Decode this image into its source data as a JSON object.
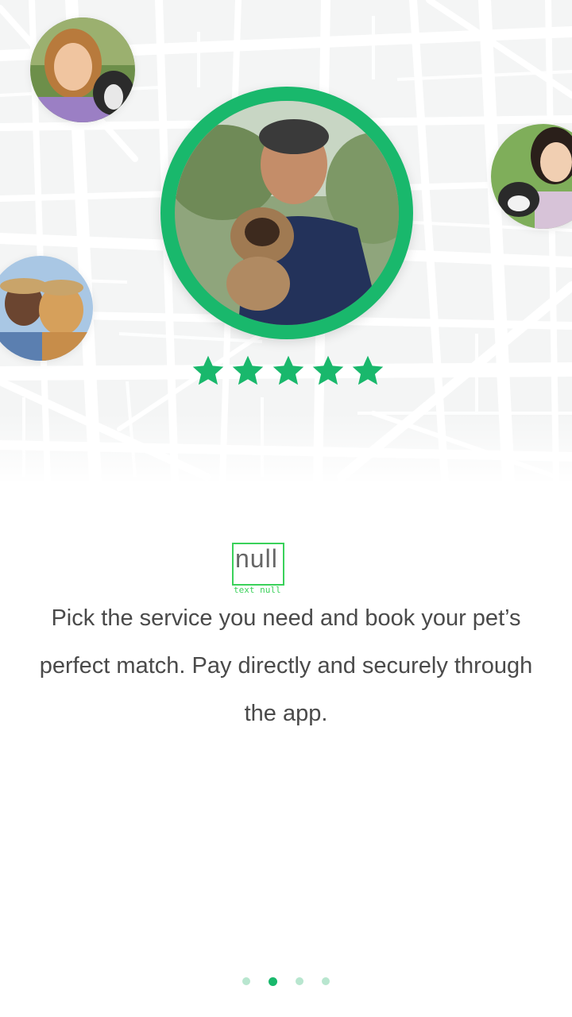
{
  "colors": {
    "accent": "#19b86c",
    "text": "#4a4a4a",
    "map_background": "#f4f5f5",
    "map_roads": "#ffffff",
    "dot_inactive": "#b8e6cf"
  },
  "hero": {
    "main_profile": {
      "image": "man-holding-small-dog-photo"
    },
    "rating": {
      "value": 5,
      "max": 5,
      "icon": "star-icon"
    },
    "side_profiles": [
      {
        "image": "woman-with-dog-photo"
      },
      {
        "image": "woman-with-dog-laughing-photo"
      },
      {
        "image": "woman-with-golden-retriever-photo"
      }
    ]
  },
  "content": {
    "title": "null",
    "title_tag": "text null",
    "description": "Pick the service you need and book your pet’s perfect match. Pay directly and securely through the app."
  },
  "pager": {
    "total": 4,
    "current": 2
  }
}
